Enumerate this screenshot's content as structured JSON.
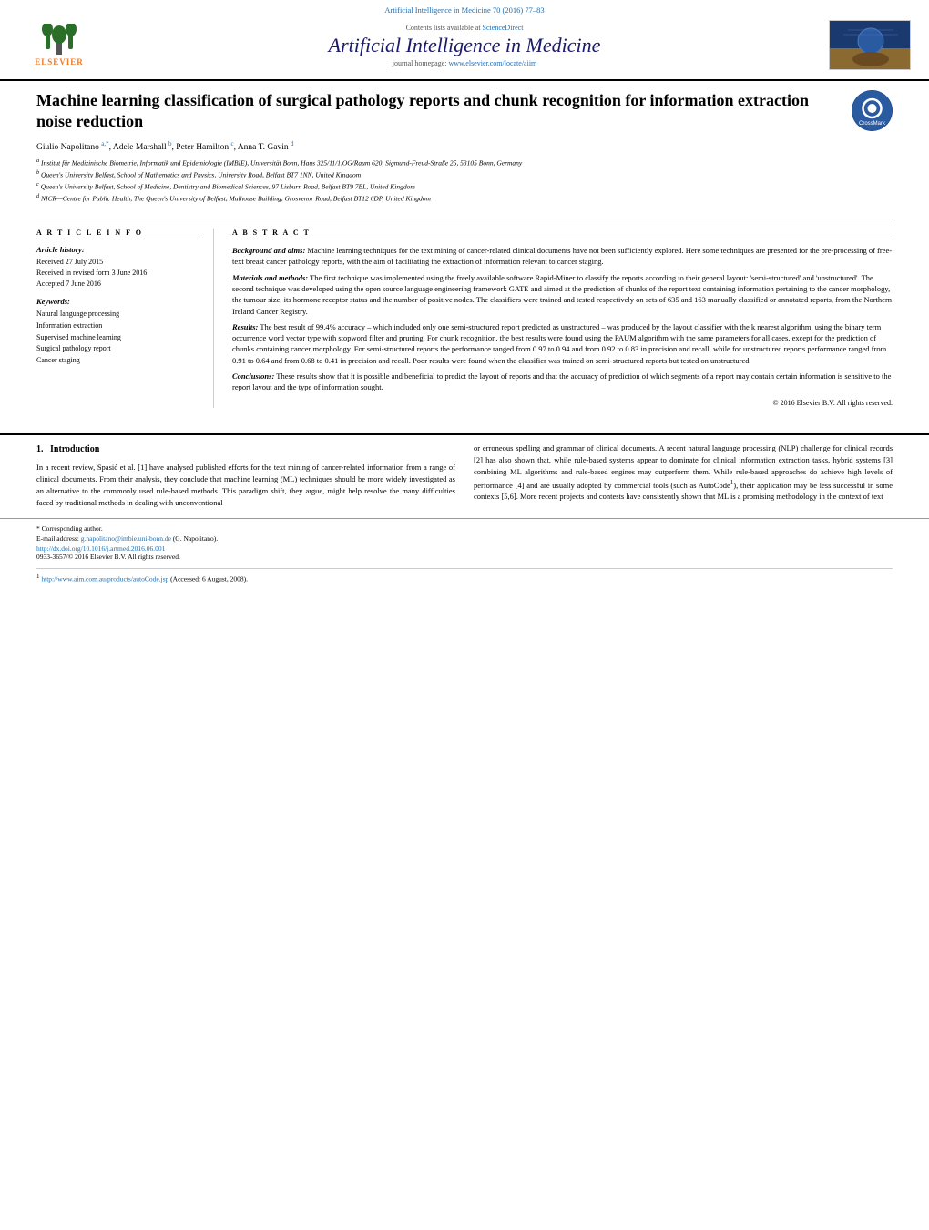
{
  "header": {
    "doi_top": "Artificial Intelligence in Medicine 70 (2016) 77–83",
    "contents_text": "Contents lists available at",
    "sciencedirect": "ScienceDirect",
    "journal_name": "Artificial Intelligence in Medicine",
    "homepage_text": "journal homepage:",
    "homepage_url": "www.elsevier.com/locate/aiim"
  },
  "article": {
    "title": "Machine learning classification of surgical pathology reports and chunk recognition for information extraction noise reduction",
    "authors": "Giulio Napolitano",
    "authors_full": "Giulio Napolitano a,*, Adele Marshall b, Peter Hamilton c, Anna T. Gavin d",
    "affiliations": [
      "a Institut für Medizinische Biometrie, Informatik und Epidemiologie (IMBIE), Universität Bonn, Haus 325/11/1.OG/Raum 620, Sigmund-Freud-Straße 25, 53105 Bonn, Germany",
      "b Queen's University Belfast, School of Mathematics and Physics, University Road, Belfast BT7 1NN, United Kingdom",
      "c Queen's University Belfast, School of Medicine, Dentistry and Biomedical Sciences, 97 Lisburn Road, Belfast BT9 7BL, United Kingdom",
      "d NICR—Centre for Public Health, The Queen's University of Belfast, Mulhouse Building, Grosvenor Road, Belfast BT12 6DP, United Kingdom"
    ],
    "article_info": {
      "heading": "A R T I C L E   I N F O",
      "history_heading": "Article history:",
      "received": "Received 27 July 2015",
      "revised": "Received in revised form 3 June 2016",
      "accepted": "Accepted 7 June 2016",
      "keywords_heading": "Keywords:",
      "keywords": [
        "Natural language processing",
        "Information extraction",
        "Supervised machine learning",
        "Surgical pathology report",
        "Cancer staging"
      ]
    },
    "abstract": {
      "heading": "A B S T R A C T",
      "background": "Background and aims: Machine learning techniques for the text mining of cancer-related clinical documents have not been sufficiently explored. Here some techniques are presented for the pre-processing of free-text breast cancer pathology reports, with the aim of facilitating the extraction of information relevant to cancer staging.",
      "materials": "Materials and methods: The first technique was implemented using the freely available software Rapid-Miner to classify the reports according to their general layout: 'semi-structured' and 'unstructured'. The second technique was developed using the open source language engineering framework GATE and aimed at the prediction of chunks of the report text containing information pertaining to the cancer morphology, the tumour size, its hormone receptor status and the number of positive nodes. The classifiers were trained and tested respectively on sets of 635 and 163 manually classified or annotated reports, from the Northern Ireland Cancer Registry.",
      "results": "Results: The best result of 99.4% accuracy – which included only one semi-structured report predicted as unstructured – was produced by the layout classifier with the k nearest algorithm, using the binary term occurrence word vector type with stopword filter and pruning. For chunk recognition, the best results were found using the PAUM algorithm with the same parameters for all cases, except for the prediction of chunks containing cancer morphology. For semi-structured reports the performance ranged from 0.97 to 0.94 and from 0.92 to 0.83 in precision and recall, while for unstructured reports performance ranged from 0.91 to 0.64 and from 0.68 to 0.41 in precision and recall. Poor results were found when the classifier was trained on semi-structured reports but tested on unstructured.",
      "conclusions": "Conclusions: These results show that it is possible and beneficial to predict the layout of reports and that the accuracy of prediction of which segments of a report may contain certain information is sensitive to the report layout and the type of information sought.",
      "copyright": "© 2016 Elsevier B.V. All rights reserved."
    }
  },
  "body": {
    "section1": {
      "number": "1.",
      "title": "Introduction",
      "para1": "In a recent review, Spasić et al. [1] have analysed published efforts for the text mining of cancer-related information from a range of clinical documents. From their analysis, they conclude that machine learning (ML) techniques should be more widely investigated as an alternative to the commonly used rule-based methods. This paradigm shift, they argue, might help resolve the many difficulties faced by traditional methods in dealing with unconventional",
      "para2": "or erroneous spelling and grammar of clinical documents. A recent natural language processing (NLP) challenge for clinical records [2] has also shown that, while rule-based systems appear to dominate for clinical information extraction tasks, hybrid systems [3] combining ML algorithms and rule-based engines may outperform them. While rule-based approaches do achieve high levels of performance [4] and are usually adopted by commercial tools (such as AutoCode1), their application may be less successful in some contexts [5,6]. More recent projects and contests have consistently shown that ML is a promising methodology in the context of text"
    }
  },
  "footnotes": {
    "corresponding": "* Corresponding author.",
    "email_label": "E-mail address:",
    "email": "g.napolitano@imbie.uni-bonn.de",
    "email_name": "(G. Napolitano).",
    "doi": "http://dx.doi.org/10.1016/j.artmed.2016.06.001",
    "issn": "0933-3657/© 2016 Elsevier B.V. All rights reserved.",
    "footnote1_url": "http://www.aim.com.au/products/autoCode.jsp",
    "footnote1_text": "(Accessed: 6 August, 2008)."
  }
}
